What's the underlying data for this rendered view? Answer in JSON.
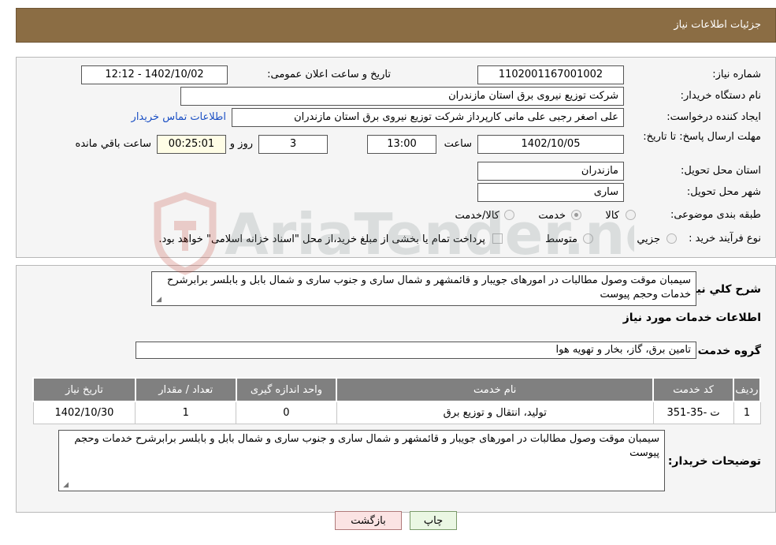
{
  "header": {
    "title": "جزئیات اطلاعات نیاز"
  },
  "form": {
    "need_number_label": "شماره نیاز:",
    "need_number": "1102001167001002",
    "announce_label": "تاریخ و ساعت اعلان عمومی:",
    "announce_value": "1402/10/02 - 12:12",
    "buyer_org_label": "نام دستگاه خریدار:",
    "buyer_org": "شرکت توزیع نیروی برق استان مازندران",
    "creator_label": "ایجاد کننده درخواست:",
    "creator": "علی اصغر رجبی علی مانی کارپرداز شرکت توزیع نیروی برق استان مازندران",
    "contact_link": "اطلاعات تماس خریدار",
    "deadline_label": "مهلت ارسال پاسخ: تا تاریخ:",
    "deadline_date": "1402/10/05",
    "time_label": "ساعت",
    "deadline_time": "13:00",
    "days_value": "3",
    "days_label": "روز و",
    "remaining_time": "00:25:01",
    "remaining_label": "ساعت باقي مانده",
    "province_label": "استان محل تحویل:",
    "province": "مازندران",
    "city_label": "شهر محل تحویل:",
    "city": "ساری",
    "category_label": "طبقه بندی موضوعی:",
    "category_options": [
      {
        "label": "کالا",
        "selected": false
      },
      {
        "label": "خدمت",
        "selected": true
      },
      {
        "label": "کالا/خدمت",
        "selected": false
      }
    ],
    "process_label": "نوع فرآیند خرید :",
    "process_options": [
      {
        "label": "جزیي",
        "selected": false
      },
      {
        "label": "متوسط",
        "selected": false
      }
    ],
    "payment_note": "پرداخت تمام یا بخشی از مبلغ خرید،از محل \"اسناد خزانه اسلامی\" خواهد بود."
  },
  "details": {
    "summary_label": "شرح کلي نياز:",
    "summary": "سیمبان موقت وصول مطالبات در امورهای جویبار و قائمشهر و شمال ساری و جنوب ساری و شمال بابل و بابلسر  برابرشرح خدمات وحجم پیوست",
    "services_heading": "اطلاعات خدمات مورد نياز",
    "service_group_label": "گروه خدمت:",
    "service_group": "تامین برق، گاز، بخار و تهویه هوا",
    "table": {
      "columns": [
        "ردیف",
        "کد خدمت",
        "نام خدمت",
        "واحد اندازه گیری",
        "تعداد / مقدار",
        "تاریخ نیاز"
      ],
      "rows": [
        [
          "1",
          "ت -35-351",
          "تولید، انتقال و توزیع برق",
          "0",
          "1",
          "1402/10/30"
        ]
      ]
    },
    "buyer_notes_label": "توضیحات خریدار:",
    "buyer_notes": "سیمبان موقت وصول مطالبات در امورهای جویبار و قائمشهر و شمال ساری و جنوب ساری و شمال بابل و بابلسر  برابرشرح خدمات وحجم پیوست"
  },
  "buttons": {
    "print": "چاپ",
    "back": "بازگشت"
  },
  "watermark": {
    "text": "AriaTender.neT"
  }
}
